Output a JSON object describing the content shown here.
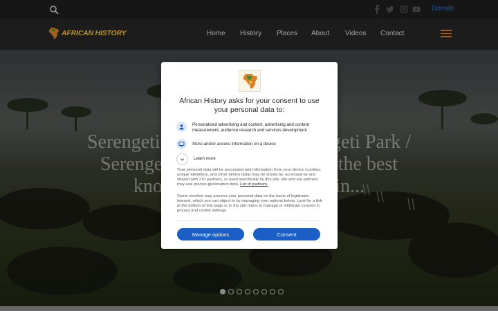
{
  "topbar": {
    "donate_label": "Donate",
    "social_icons": [
      "facebook-icon",
      "twitter-icon",
      "instagram-icon",
      "youtube-icon"
    ]
  },
  "header": {
    "logo_text": "AFRICAN HISTORY",
    "nav": [
      {
        "label": "Home"
      },
      {
        "label": "History"
      },
      {
        "label": "Places"
      },
      {
        "label": "About"
      },
      {
        "label": "Videos"
      },
      {
        "label": "Contact"
      }
    ]
  },
  "hero": {
    "title_line1": "Serengeti National Park / Serengeti Park /",
    "title_line2": "Serengeti Park is undoubtedly the best",
    "title_line3": "known wildlife sanctuary in..."
  },
  "slider": {
    "count": 8,
    "active": 0
  },
  "consent": {
    "title": "African History asks for your consent to use your personal data to:",
    "purposes": [
      {
        "icon": "person-icon",
        "text": "Personalised advertising and content, advertising and content measurement, audience research and services development"
      },
      {
        "icon": "device-icon",
        "text": "Store and/or access information on a device"
      }
    ],
    "learn_more": "Learn more",
    "para1": "Your personal data will be processed and information from your device (cookies, unique identifiers, and other device data) may be stored by, accessed by and shared with 210 partners, or used specifically by this site. We and our partners may use precise geolocation data.",
    "partners_link": "List of partners.",
    "para2": "Some vendors may process your personal data on the basis of legitimate interest, which you can object to by managing your options below. Look for a link at the bottom of this page or in the site menu to manage or withdraw consent in privacy and cookie settings.",
    "manage_label": "Manage options",
    "consent_label": "Consent"
  },
  "colors": {
    "accent": "#1b5fc6",
    "logo": "#f0c040",
    "menu": "#d9822b"
  }
}
